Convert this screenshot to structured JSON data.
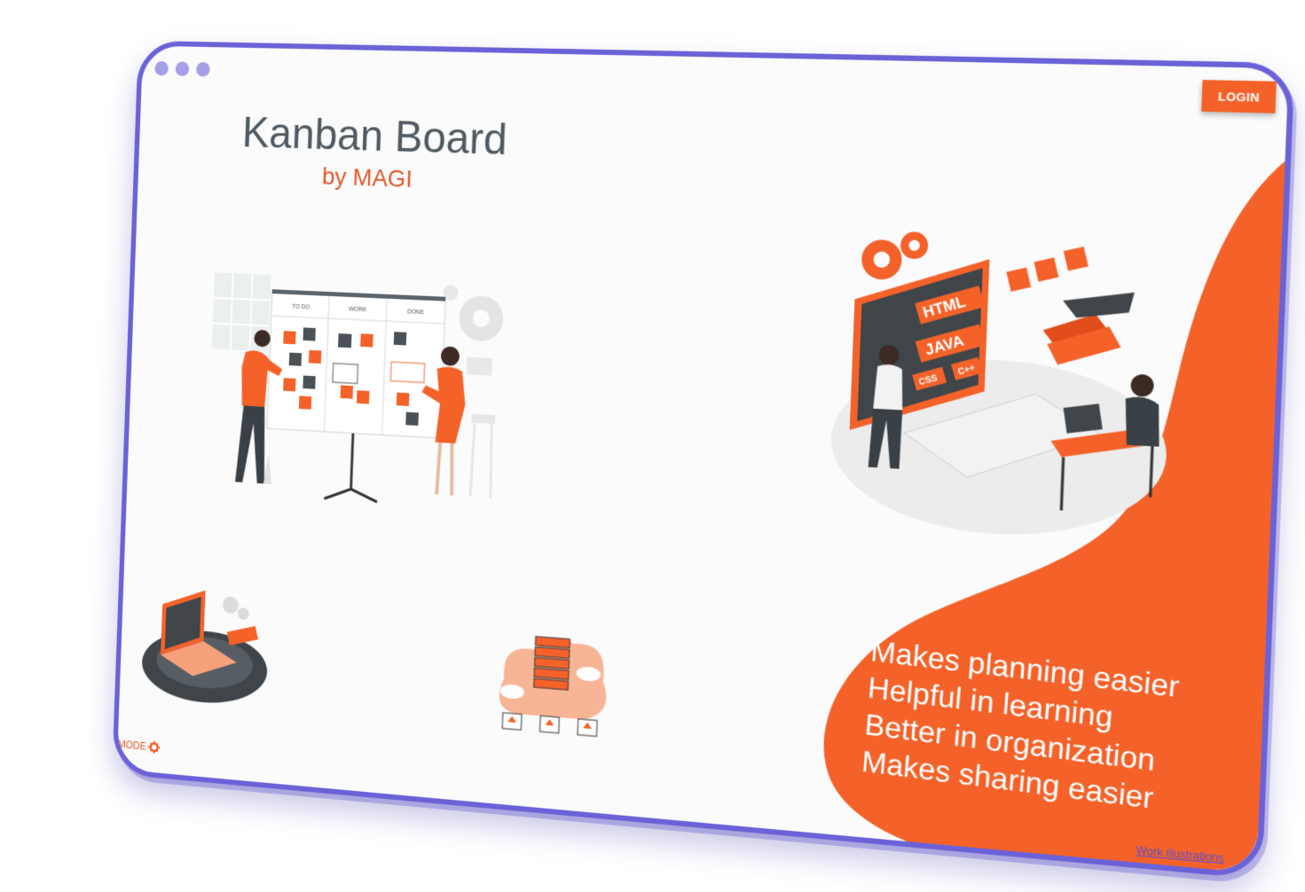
{
  "window": {
    "dot_count": 3
  },
  "header": {
    "login_label": "LOGIN"
  },
  "hero": {
    "title": "Kanban Board",
    "subtitle": "by MAGI"
  },
  "kanban_illustration": {
    "columns": [
      "TO DO",
      "WORK",
      "DONE"
    ]
  },
  "coding_illustration": {
    "labels": [
      "HTML",
      "JAVA",
      "CSS",
      "C++"
    ]
  },
  "features": [
    "Makes planning easier",
    "Helpful in learning",
    "Better in organization",
    "Makes sharing easier"
  ],
  "footer": {
    "credit": "Work illustrations",
    "mode_label": "MODE"
  },
  "colors": {
    "accent": "#f4622a",
    "frame": "#6b62d8",
    "title": "#4f5a63",
    "background": "#fbfbfb"
  },
  "icons": {
    "login": "none",
    "mode": "sun-gear-icon"
  }
}
